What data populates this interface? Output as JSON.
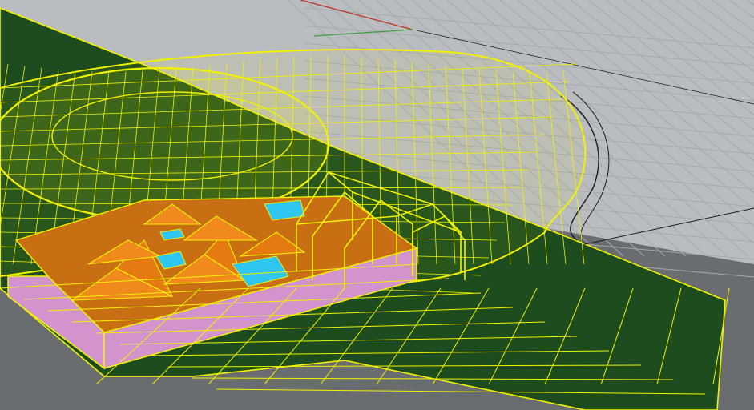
{
  "viewport": {
    "mode": "perspective-3d",
    "display": "wireframe-shaded",
    "selection_state": "selected"
  },
  "colors": {
    "background_grid_plane": "#babdc0",
    "background_grid_shadow": "#6a6d70",
    "grid_line": "#a9acb0",
    "ground_surface": "#1d4d1f",
    "selection_wireframe": "#f2f200",
    "roof_orange": "#f08a1c",
    "wall_pink": "#d393cc",
    "glass_cyan": "#2fc6f2",
    "axis_x": "#c0392b",
    "axis_y": "#3e9b3e",
    "curve_black": "#1a1a1a"
  },
  "objects": [
    {
      "name": "ground-terrain-surface",
      "type": "surface",
      "selected": true
    },
    {
      "name": "canopy-shell-mesh",
      "type": "mesh",
      "selected": true
    },
    {
      "name": "building-roof-pyramids",
      "type": "polysurface",
      "selected": true
    },
    {
      "name": "building-walls",
      "type": "polysurface",
      "selected": true
    },
    {
      "name": "glass-skylights",
      "type": "surface",
      "selected": true
    },
    {
      "name": "gable-frame-structure",
      "type": "curves",
      "selected": true
    },
    {
      "name": "boundary-curve",
      "type": "curve",
      "selected": false
    }
  ]
}
